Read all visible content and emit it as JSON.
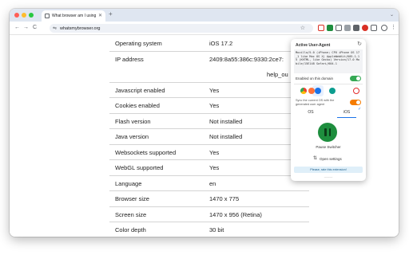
{
  "tab": {
    "title": "What browser am I using?",
    "close_glyph": "✕",
    "new_tab_glyph": "+"
  },
  "toolbar": {
    "back_glyph": "←",
    "forward_glyph": "→",
    "reload_glyph": "C",
    "url": "whatsmybrowser.org",
    "star_glyph": "☆"
  },
  "table": {
    "rows": [
      {
        "key": "Operating system",
        "value": "iOS 17.2"
      },
      {
        "key": "IP address",
        "value": "2409:8a55:386c:9330:2ce7:",
        "value2": "help_ou"
      },
      {
        "key": "Javascript enabled",
        "value": "Yes"
      },
      {
        "key": "Cookies enabled",
        "value": "Yes"
      },
      {
        "key": "Flash version",
        "value": "Not installed"
      },
      {
        "key": "Java version",
        "value": "Not installed"
      },
      {
        "key": "Websockets supported",
        "value": "Yes"
      },
      {
        "key": "WebGL supported",
        "value": "Yes"
      },
      {
        "key": "Language",
        "value": "en"
      },
      {
        "key": "Browser size",
        "value": "1470 x 775"
      },
      {
        "key": "Screen size",
        "value": "1470 x 956 (Retina)"
      },
      {
        "key": "Color depth",
        "value": "30 bit"
      }
    ]
  },
  "popup": {
    "title": "Active User-Agent",
    "refresh_glyph": "↻",
    "user_agent": "Mozilla/5.0 (iPhone; CPU iPhone OS 17_1 like Mac OS X) AppleWebKit/605.1.15 (KHTML, like Gecko) Version/17.0 Mobile/15E148 Safari/604.1",
    "enabled_label": "Enabled on this domain",
    "enabled": true,
    "sync_label": "Sync the current OS with the generated user agent",
    "sync_enabled": true,
    "os_tabs": [
      {
        "glyph": "",
        "label": "OS"
      },
      {
        "glyph": "",
        "label": "iOS"
      }
    ],
    "selected_os": "iOS",
    "pause_label": "Pause Switcher",
    "settings_label": "Open settings",
    "rate_label": "Please, rate this extension!"
  },
  "colors": {
    "toggle_on": "#34a853",
    "toggle_orange": "#f57c00",
    "pause_green": "#1e8e3e",
    "accent_blue": "#1a73e8"
  }
}
